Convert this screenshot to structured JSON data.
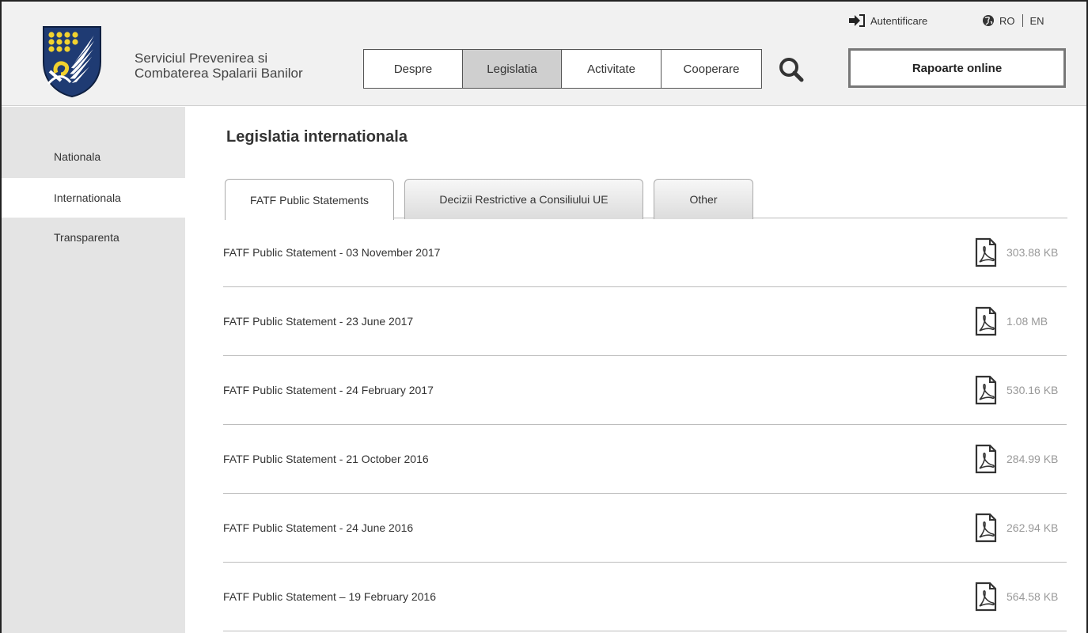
{
  "header": {
    "org_name_line1": "Serviciul Prevenirea si",
    "org_name_line2": "Combaterea Spalarii Banilor",
    "nav": [
      "Despre",
      "Legislatia",
      "Activitate",
      "Cooperare"
    ],
    "active_nav": "Legislatia",
    "report_button": "Rapoarte online",
    "login_label": "Autentificare",
    "lang_ro": "RO",
    "lang_en": "EN"
  },
  "sidebar": {
    "items": [
      "Nationala",
      "Internationala",
      "Transparenta"
    ],
    "active": "Internationala"
  },
  "main": {
    "title": "Legislatia internationala",
    "tabs": [
      "FATF Public Statements",
      "Decizii Restrictive a Consiliului UE",
      "Other"
    ],
    "active_tab": "FATF Public Statements",
    "documents": [
      {
        "title": "FATF Public Statement - 03 November 2017",
        "size": "303.88 KB"
      },
      {
        "title": "FATF Public Statement - 23 June 2017",
        "size": "1.08 MB"
      },
      {
        "title": "FATF Public Statement - 24 February 2017",
        "size": "530.16 KB"
      },
      {
        "title": "FATF Public Statement - 21 October 2016",
        "size": "284.99 KB"
      },
      {
        "title": "FATF Public Statement - 24 June 2016",
        "size": "262.94 KB"
      },
      {
        "title": "FATF Public Statement – 19 February 2016",
        "size": "564.58 KB"
      }
    ]
  },
  "colors": {
    "header_bg": "#f1f1f1",
    "sidebar_bg": "#e4e4e4",
    "active_nav_bg": "#cfcfcf",
    "logo_navy": "#1f3b73",
    "logo_gold": "#f2d22e"
  },
  "icons": {
    "logo": "coat-of-arms-shield",
    "search": "magnifier-icon",
    "login": "sign-in-icon",
    "language": "globe-icon",
    "file": "pdf-icon"
  }
}
